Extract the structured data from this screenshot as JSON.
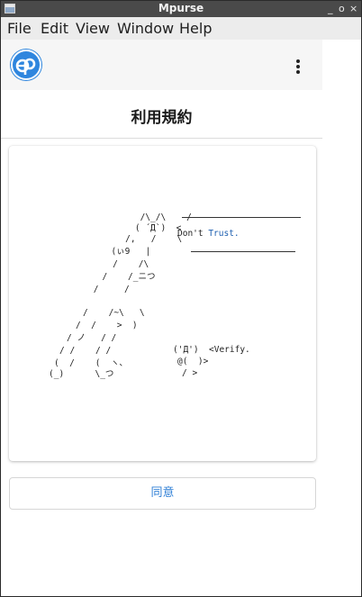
{
  "window": {
    "title": "Mpurse",
    "controls": {
      "minimize": "_",
      "restore": "o",
      "close": "×"
    }
  },
  "menubar": {
    "items": [
      "File",
      "Edit",
      "View",
      "Window",
      "Help"
    ]
  },
  "appbar": {
    "logo_icon": "mpurse-logo-icon",
    "menu_icon": "kebab-menu-icon"
  },
  "page": {
    "title": "利用規約",
    "agree_button": "同意"
  },
  "ascii_art": {
    "lines": [
      "     /\\_/\\    /",
      "    ( ´Д`)  <",
      "   /,   /    \\",
      "  (ぃ9   |",
      "   /    /\\",
      "  /    /_ニつ",
      " /     /",
      "/    /~\\   \\",
      "/  /    >  )",
      "/ ノ   / /",
      "/ /    / /",
      "(  /    (  ヽ、",
      "(_)      \\_つ"
    ],
    "speech_dont_trust": "Don't Trust.",
    "small_face": "('Д')",
    "small_body": "@(  )>",
    "small_legs": "/ >",
    "speech_verify": "<Verify."
  },
  "colors": {
    "titlebar": "#4a4a4a",
    "menubar": "#ececec",
    "appbar": "#f6f6f6",
    "accent": "#2f86de",
    "link_text": "#2f7fd6"
  }
}
